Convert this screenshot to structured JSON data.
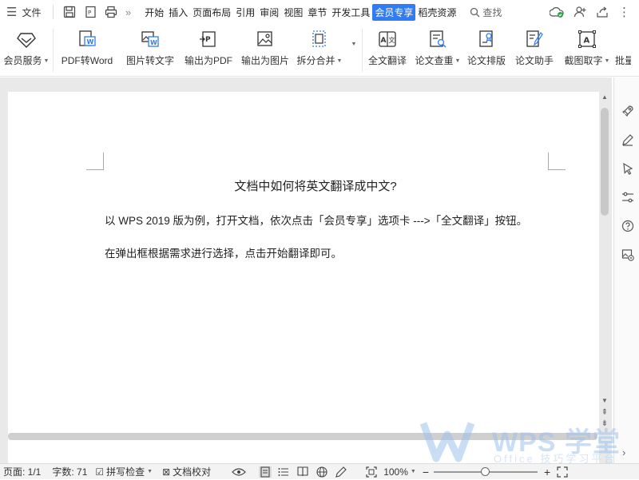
{
  "menu": {
    "file_label": "文件"
  },
  "tabs": [
    "开始",
    "插入",
    "页面布局",
    "引用",
    "审阅",
    "视图",
    "章节",
    "开发工具",
    "会员专享",
    "稻壳资源"
  ],
  "active_tab": "会员专享",
  "search": {
    "label": "查找"
  },
  "ribbon": {
    "member_service": "会员服务",
    "pdf_to_word": "PDF转Word",
    "image_to_text": "图片转文字",
    "export_pdf": "输出为PDF",
    "export_image": "输出为图片",
    "split_merge": "拆分合并",
    "full_translate": "全文翻译",
    "paper_check": "论文查重",
    "paper_layout": "论文排版",
    "paper_assistant": "论文助手",
    "screenshot_text": "截图取字",
    "batch": "批量"
  },
  "document": {
    "title": "文档中如何将英文翻译成中文?",
    "paragraph1": "以 WPS 2019 版为例，打开文档，依次点击「会员专享」选项卡  --->「全文翻译」按钮。",
    "paragraph2": "在弹出框根据需求进行选择，点击开始翻译即可。"
  },
  "status": {
    "page": "页面: 1/1",
    "word_count": "字数: 71",
    "spell_check": "拼写检查",
    "doc_proof": "文档校对",
    "zoom": "100%",
    "zoom_fraction": 0.5
  },
  "watermark": {
    "brand": "WPS 学堂",
    "sub": "Office 技巧学习平台"
  },
  "colors": {
    "accent": "#2f7cf6",
    "online": "#2aa34a"
  }
}
